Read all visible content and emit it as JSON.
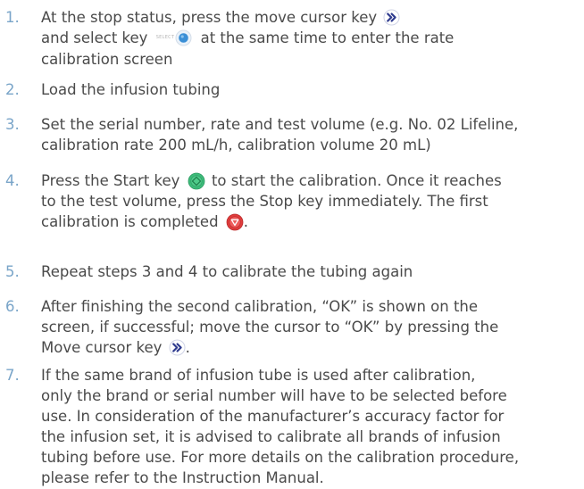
{
  "steps": [
    {
      "number": "1.",
      "line1": "At the stop status, press the move cursor key",
      "line2a": "and select key",
      "select_icon_label": "SELECT",
      "line2b": "at the same time to enter the rate",
      "line3": "calibration screen"
    },
    {
      "number": "2.",
      "line1": "Load the infusion tubing"
    },
    {
      "number": "3.",
      "line1": "Set the serial number, rate and test volume (e.g. No. 02 Lifeline,",
      "line2": "calibration rate 200 mL/h, calibration volume 20 mL)"
    },
    {
      "number": "4.",
      "line1a": "Press the Start key",
      "line1b": "to start the calibration. Once it reaches",
      "line2": "to the test volume, press the Stop key immediately. The first",
      "line3": "calibration is completed",
      "line3b": "."
    },
    {
      "number": "5.",
      "line1": "Repeat steps 3 and 4 to calibrate the tubing again"
    },
    {
      "number": "6.",
      "line1": "After finishing the second calibration, “OK” is shown on the",
      "line2": "screen, if successful; move the cursor to “OK” by pressing the",
      "line3": "Move cursor key",
      "line3b": "."
    },
    {
      "number": "7.",
      "line1": "If the same brand of infusion tube is used after calibration,",
      "line2": "only the brand or serial number will have to be selected before",
      "line3": "use. In consideration of the manufacturer’s accuracy factor for",
      "line4": "the infusion set, it is advised to calibrate all brands of infusion",
      "line5": "tubing before use. For more details on the calibration procedure,",
      "line6": "please refer to the Instruction Manual."
    }
  ],
  "icons": {
    "move_cursor": "move-cursor-key-icon",
    "select": "select-key-icon",
    "start": "start-key-icon",
    "stop": "stop-key-icon"
  },
  "colors": {
    "text": "#4a4a4a",
    "step_number": "#7aa5c9",
    "move_cursor_key": "#2f3b8f",
    "select_key": "#3a8fd6",
    "start_key": "#3dbb7a",
    "stop_key": "#e03c3c"
  }
}
